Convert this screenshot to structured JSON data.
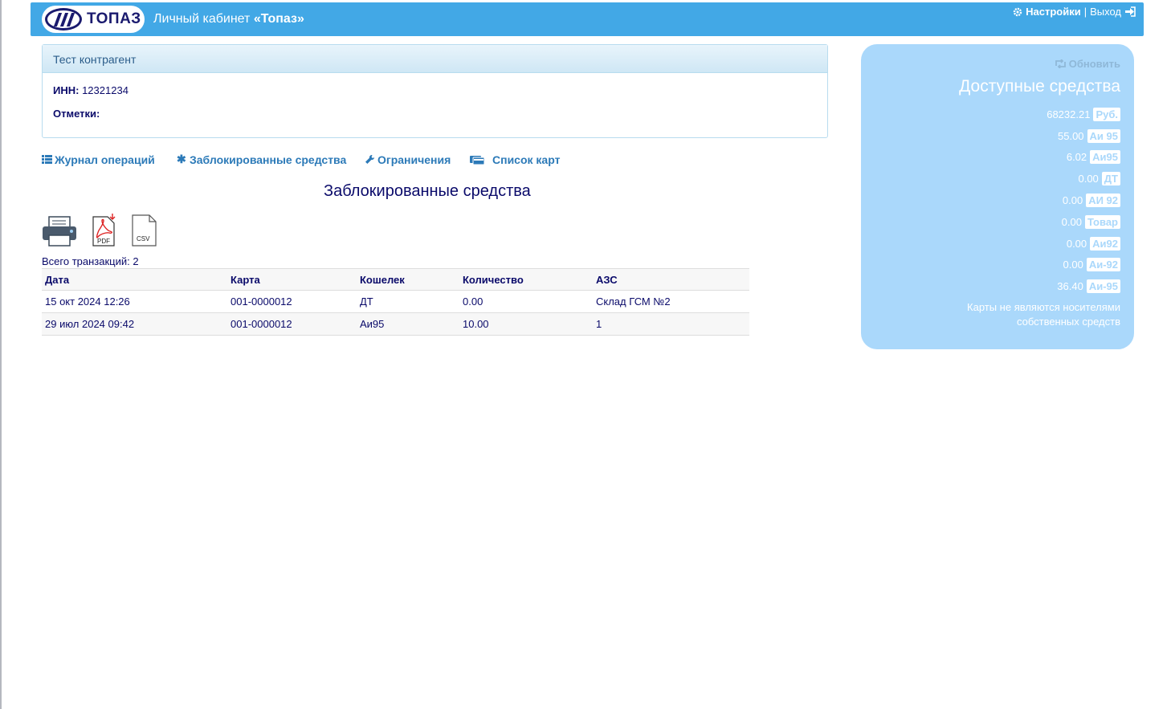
{
  "header": {
    "logo_text": "ТОПАЗ",
    "title_prefix": "Личный кабинет ",
    "title_brand": "«Топаз»",
    "settings_label": "Настройки",
    "separator": "|",
    "logout_label": "Выход"
  },
  "account": {
    "name": "Тест контрагент",
    "inn_label": "ИНН:",
    "inn_value": "12321234",
    "notes_label": "Отметки:",
    "notes_value": ""
  },
  "tabs": [
    {
      "label": "Журнал операций",
      "icon": "list-icon"
    },
    {
      "label": "Заблокированные средства",
      "icon": "asterisk-icon"
    },
    {
      "label": "Ограничения",
      "icon": "wrench-icon"
    },
    {
      "label": "Список карт",
      "icon": "cards-icon"
    }
  ],
  "page_title": "Заблокированные средства",
  "exports": {
    "print": "print-icon",
    "pdf_label": "PDF",
    "csv_label": "CSV"
  },
  "total_label": "Всего транзакций: 2",
  "table": {
    "headers": [
      "Дата",
      "Карта",
      "Кошелек",
      "Количество",
      "АЗС"
    ],
    "rows": [
      [
        "15 окт 2024 12:26",
        "001-0000012",
        "ДТ",
        "0.00",
        "Склад ГСМ №2"
      ],
      [
        "29 июл 2024 09:42",
        "001-0000012",
        "Аи95",
        "10.00",
        "1"
      ]
    ]
  },
  "funds": {
    "refresh_label": "Обновить",
    "title": "Доступные средства",
    "items": [
      {
        "amount": "68232.21",
        "unit": "Руб."
      },
      {
        "amount": "55.00",
        "unit": "Аи 95"
      },
      {
        "amount": "6.02",
        "unit": "Аи95"
      },
      {
        "amount": "0.00",
        "unit": "ДТ"
      },
      {
        "amount": "0.00",
        "unit": "АИ 92"
      },
      {
        "amount": "0.00",
        "unit": "Товар"
      },
      {
        "amount": "0.00",
        "unit": "Аи92"
      },
      {
        "amount": "0.00",
        "unit": "Аи-92"
      },
      {
        "amount": "36.40",
        "unit": "Аи-95"
      }
    ],
    "note": "Карты не являются носителями собственных средств"
  },
  "colors": {
    "navbar": "#42a8e6",
    "funds_panel": "#aad8fb",
    "text": "#0a0a6a",
    "link": "#2c7ab8"
  }
}
